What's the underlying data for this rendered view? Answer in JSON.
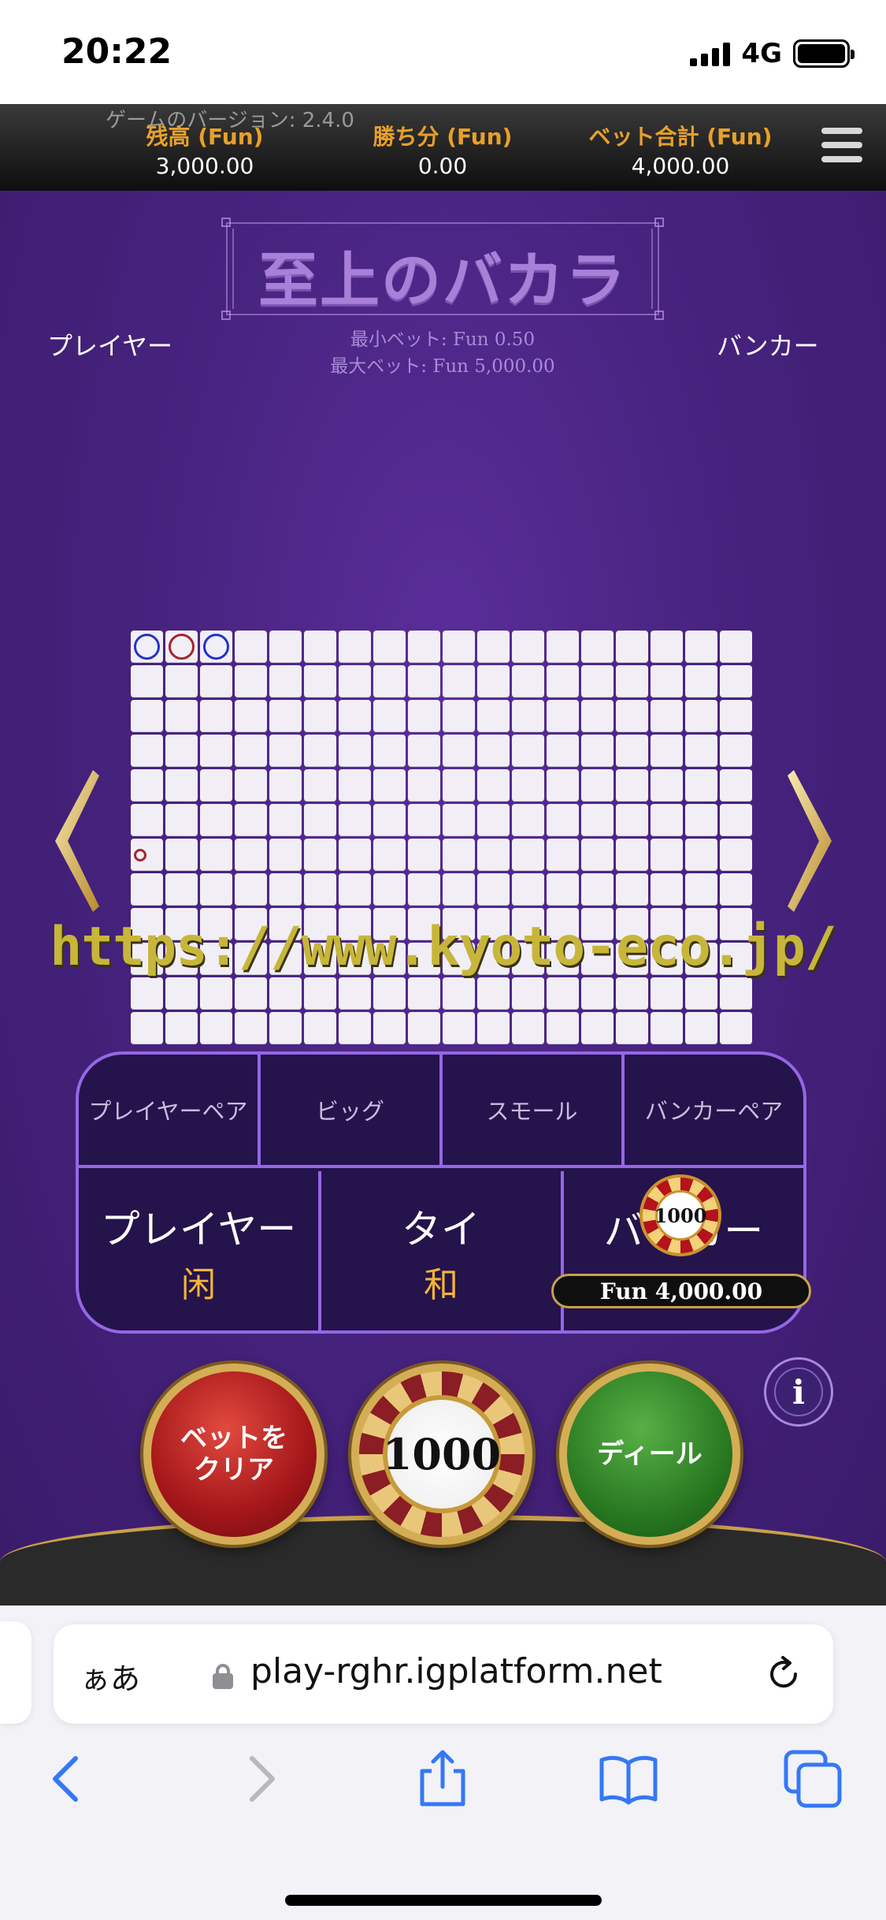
{
  "status_bar": {
    "time": "20:22",
    "network": "4G"
  },
  "game": {
    "version": "ゲームのバージョン: 2.4.0",
    "stats": [
      {
        "label": "残高 (Fun)",
        "value": "3,000.00"
      },
      {
        "label": "勝ち分 (Fun)",
        "value": "0.00"
      },
      {
        "label": "ベット合計 (Fun)",
        "value": "4,000.00"
      }
    ],
    "title": "至上のバカラ",
    "player_label": "プレイヤー",
    "banker_label": "バンカー",
    "min_bet": "最小ベット: Fun 0.50",
    "max_bet": "最大ベット: Fun 5,000.00",
    "road": {
      "columns": 18,
      "rows": 12,
      "marks": [
        {
          "col": 0,
          "row": 0,
          "color": "blue"
        },
        {
          "col": 1,
          "row": 0,
          "color": "red"
        },
        {
          "col": 2,
          "row": 0,
          "color": "blue"
        },
        {
          "col": 0,
          "row": 6,
          "color": "red",
          "size": "small"
        }
      ]
    },
    "watermark": "https://www.kyoto-eco.jp/",
    "side_bets": [
      "プレイヤーペア",
      "ビッグ",
      "スモール",
      "バンカーペア"
    ],
    "main_bets": [
      {
        "label": "プレイヤー",
        "sub": "闲"
      },
      {
        "label": "タイ",
        "sub": "和"
      },
      {
        "label": "バンカー",
        "sub": ""
      }
    ],
    "placed_chip": "1000",
    "placed_amount": "Fun 4,000.00",
    "buttons": {
      "clear": "ベットを\nクリア",
      "chip": "1000",
      "deal": "ディール",
      "info": "i"
    }
  },
  "browser": {
    "aa": "ぁあ",
    "url": "play-rghr.igplatform.net"
  },
  "icons": {
    "back": "chevron-left-icon",
    "forward": "chevron-right-icon",
    "share": "share-icon",
    "bookmarks": "book-icon",
    "tabs": "tabs-icon"
  },
  "colors": {
    "accent_orange": "#e8a02b",
    "table_border": "#9467e6",
    "blue_mark": "#2432c8",
    "red_mark": "#a3252e",
    "ios_blue": "#3478f6"
  }
}
